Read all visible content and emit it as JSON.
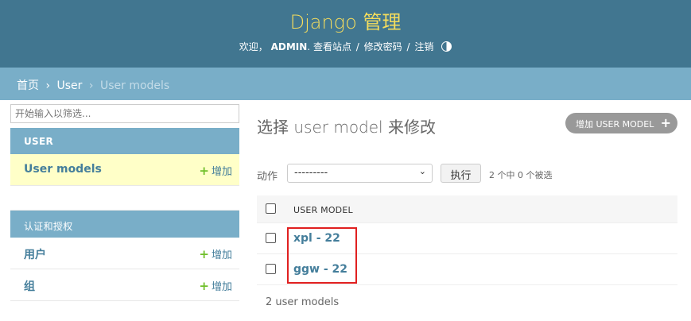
{
  "header": {
    "brand": "Django 管理",
    "welcome": "欢迎，",
    "username": "ADMIN",
    "view_site": "查看站点",
    "change_password": "修改密码",
    "logout": "注销",
    "theme_icon": "contrast-icon",
    "colors": {
      "header_bg": "#417690",
      "brand_text": "#f5dd5d"
    }
  },
  "breadcrumbs": {
    "home": "首页",
    "app": "User",
    "current": "User models",
    "separator": "›"
  },
  "sidebar": {
    "filter_placeholder": "开始输入以筛选...",
    "apps": [
      {
        "caption": "USER",
        "models": [
          {
            "name": "User models",
            "add_label": "增加",
            "current": true
          }
        ]
      },
      {
        "caption": "认证和授权",
        "models": [
          {
            "name": "用户",
            "add_label": "增加"
          },
          {
            "name": "组",
            "add_label": "增加"
          }
        ]
      }
    ]
  },
  "main": {
    "title": "选择 user model 来修改",
    "add_button": "增加 USER MODEL",
    "add_icon": "plus-icon",
    "actions": {
      "label": "动作",
      "selected_option": "---------",
      "go_button": "执行",
      "selection_status": "2 个中 0 个被选"
    },
    "table": {
      "column_header": "USER MODEL",
      "rows": [
        "xpl - 22",
        "ggw - 22"
      ],
      "footer": "2 user models"
    }
  }
}
